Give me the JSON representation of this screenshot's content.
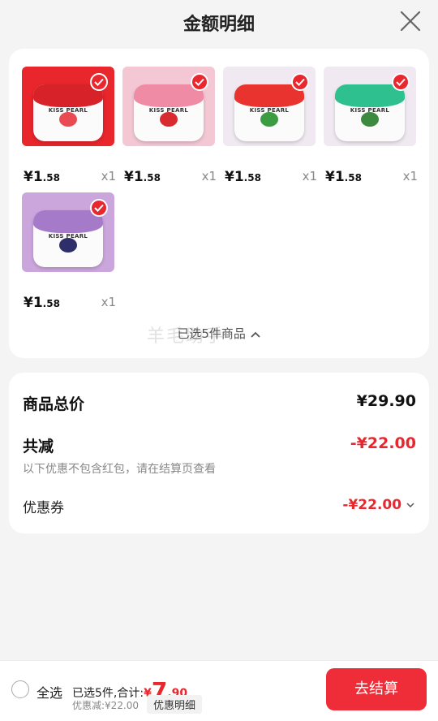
{
  "header": {
    "title": "金额明细"
  },
  "products": [
    {
      "brand": "KISS PEARL",
      "price_int": "¥1",
      "price_dec": ".58",
      "qty": "x1",
      "bg": "#e8262c",
      "lid": "#d72229",
      "fruit": "#e94b52",
      "bg_style": "red"
    },
    {
      "brand": "KISS PEARL",
      "price_int": "¥1",
      "price_dec": ".58",
      "qty": "x1",
      "bg": "#f3c8d4",
      "lid": "#f08ba5",
      "fruit": "#d72b2f",
      "bg_style": "pink"
    },
    {
      "brand": "KISS PEARL",
      "price_int": "¥1",
      "price_dec": ".58",
      "qty": "x1",
      "bg": "#f0e9f1",
      "lid": "#e8332e",
      "fruit": "#3c9c41",
      "bg_style": "lightpurple"
    },
    {
      "brand": "KISS PEARL",
      "price_int": "¥1",
      "price_dec": ".58",
      "qty": "x1",
      "bg": "#f0e9f1",
      "lid": "#2fc08f",
      "fruit": "#3b8a3f",
      "bg_style": "lightpurple"
    },
    {
      "brand": "KISS PEARL",
      "price_int": "¥1",
      "price_dec": ".58",
      "qty": "x1",
      "bg": "#cba6dd",
      "lid": "#a57ac8",
      "fruit": "#2e2e6a",
      "bg_style": "purple"
    }
  ],
  "collapse_label": "已选5件商品",
  "watermark": "羊毛助手",
  "summary": {
    "total_label": "商品总价",
    "total_value": "¥29.90",
    "reduce_label": "共减",
    "reduce_value": "-¥22.00",
    "note": "以下优惠不包含红包，请在结算页查看",
    "coupon_label": "优惠券",
    "coupon_value": "-¥22.00"
  },
  "bottom": {
    "select_all": "全选",
    "count_text": "已选5件,合计:",
    "currency": "¥",
    "amount_int": "7",
    "amount_dec": ".90",
    "discount": "优惠减:¥22.00",
    "detail": "优惠明细",
    "checkout": "去结算"
  },
  "colors": {
    "accent": "#e8272e",
    "checkout": "#ef2d38"
  }
}
